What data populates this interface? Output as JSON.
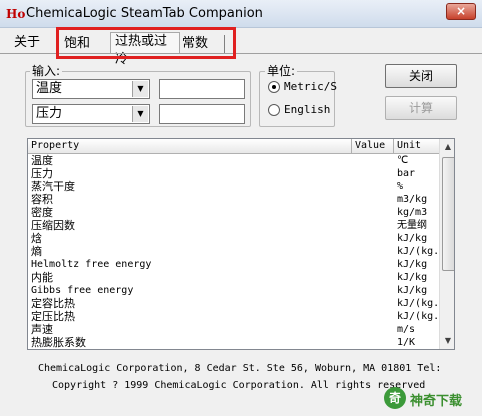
{
  "window": {
    "title": "ChemicaLogic SteamTab Companion",
    "icon_text": "Ho",
    "close_glyph": "×"
  },
  "menu": {
    "about": "关于"
  },
  "tabs": [
    {
      "label": "饱和"
    },
    {
      "label": "过热或过冷",
      "active": true
    },
    {
      "label": "常数"
    }
  ],
  "inputs": {
    "legend": "输入:",
    "field1": {
      "selected": "温度",
      "value": ""
    },
    "field2": {
      "selected": "压力",
      "value": ""
    }
  },
  "units": {
    "legend": "单位:",
    "options": [
      {
        "label": "Metric/S",
        "checked": true
      },
      {
        "label": "English",
        "checked": false
      }
    ]
  },
  "buttons": {
    "close": "关闭",
    "calculate": "计算"
  },
  "table": {
    "headers": {
      "property": "Property",
      "value": "Value",
      "unit": "Unit"
    },
    "rows": [
      {
        "property": "温度",
        "unit": "℃"
      },
      {
        "property": "压力",
        "unit": "bar"
      },
      {
        "property": "蒸汽干度",
        "unit": "%"
      },
      {
        "property": "容积",
        "unit": "m3/kg"
      },
      {
        "property": "密度",
        "unit": "kg/m3"
      },
      {
        "property": "压缩因数",
        "unit": "无量纲"
      },
      {
        "property": "焓",
        "unit": "kJ/kg"
      },
      {
        "property": "熵",
        "unit": "kJ/(kg."
      },
      {
        "property": "Helmoltz free energy",
        "unit": "kJ/kg"
      },
      {
        "property": "内能",
        "unit": "kJ/kg"
      },
      {
        "property": "Gibbs free energy",
        "unit": "kJ/kg"
      },
      {
        "property": "定容比热",
        "unit": "kJ/(kg."
      },
      {
        "property": "定压比热",
        "unit": "kJ/(kg."
      },
      {
        "property": "声速",
        "unit": "m/s"
      },
      {
        "property": "热膨胀系数",
        "unit": "1/K"
      }
    ]
  },
  "footer": {
    "line1": "ChemicaLogic Corporation, 8 Cedar St. Ste 56, Woburn, MA 01801 Tel:",
    "line2": "Copyright ? 1999 ChemicaLogic Corporation. All rights reserved"
  },
  "watermark": {
    "icon_text": "奇",
    "text": "神奇下载"
  },
  "colors": {
    "highlight": "#e02020",
    "close_button": "#c7412b"
  }
}
